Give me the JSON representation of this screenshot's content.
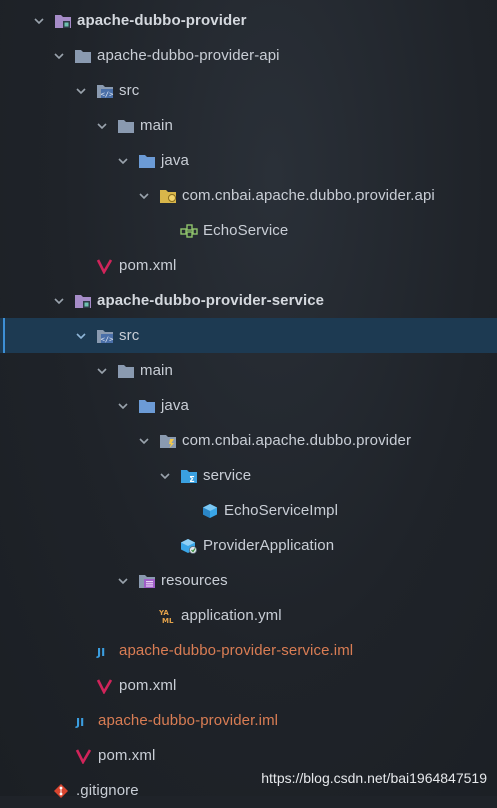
{
  "tree": {
    "root_module": {
      "label": "apache-dubbo-provider"
    },
    "api_module": {
      "label": "apache-dubbo-provider-api"
    },
    "api_src": {
      "label": "src"
    },
    "api_main": {
      "label": "main"
    },
    "api_java": {
      "label": "java"
    },
    "api_package": {
      "label": "com.cnbai.apache.dubbo.provider.api"
    },
    "api_echo_service": {
      "label": "EchoService"
    },
    "api_pom": {
      "label": "pom.xml"
    },
    "service_module": {
      "label": "apache-dubbo-provider-service"
    },
    "service_src": {
      "label": "src"
    },
    "service_main": {
      "label": "main"
    },
    "service_java": {
      "label": "java"
    },
    "service_package": {
      "label": "com.cnbai.apache.dubbo.provider"
    },
    "service_folder": {
      "label": "service"
    },
    "service_impl": {
      "label": "EchoServiceImpl"
    },
    "provider_application": {
      "label": "ProviderApplication"
    },
    "resources": {
      "label": "resources"
    },
    "application_yml": {
      "label": "application.yml"
    },
    "service_iml": {
      "label": "apache-dubbo-provider-service.iml"
    },
    "service_pom": {
      "label": "pom.xml"
    },
    "root_iml": {
      "label": "apache-dubbo-provider.iml"
    },
    "root_pom": {
      "label": "pom.xml"
    },
    "gitignore": {
      "label": ".gitignore"
    }
  },
  "watermark": "https://blog.csdn.net/bai1964847519",
  "colors": {
    "background": "#1f2329",
    "selected_row": "#1d3a52",
    "iml_text": "#d97d54",
    "folder": "#8a9ab0",
    "source_folder": "#6c9bd6",
    "maven": "#d0245a"
  },
  "selected": "service_src"
}
